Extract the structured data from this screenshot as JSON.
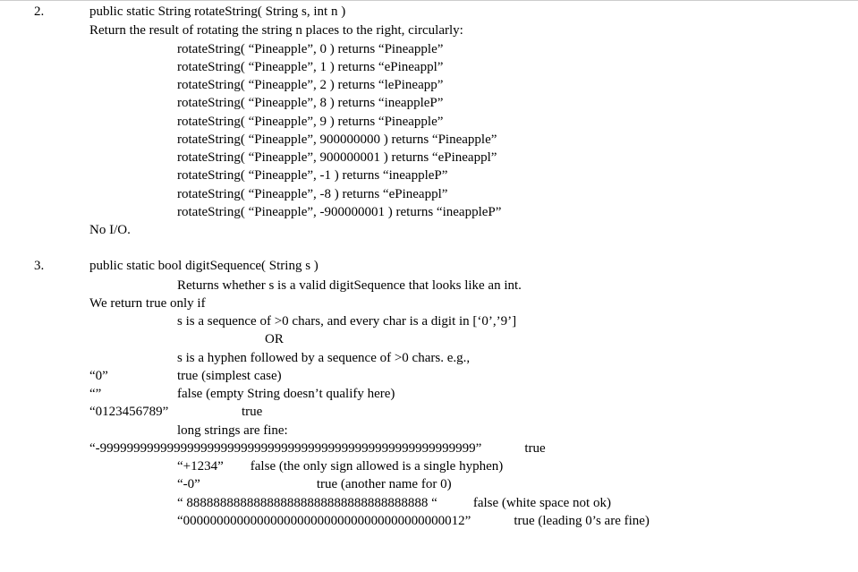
{
  "problem2": {
    "number": "2.",
    "signature": "public static String rotateString( String s, int n )",
    "description": "Return the result of rotating the string n places to the right, circularly:",
    "examples": [
      "rotateString( “Pineapple”, 0 ) returns “Pineapple”",
      "rotateString( “Pineapple”, 1 ) returns “ePineappl”",
      "rotateString( “Pineapple”, 2 ) returns “lePineapp”",
      "rotateString( “Pineapple”, 8 ) returns “ineappleP”",
      "rotateString( “Pineapple”, 9 ) returns “Pineapple”",
      "rotateString( “Pineapple”, 900000000 ) returns “Pineapple”",
      "rotateString( “Pineapple”, 900000001 ) returns “ePineappl”",
      "rotateString( “Pineapple”, -1 ) returns “ineappleP”",
      "rotateString( “Pineapple”, -8 ) returns “ePineappl”",
      "rotateString( “Pineapple”, -900000001 ) returns “ineappleP”"
    ],
    "note": "No I/O."
  },
  "problem3": {
    "number": "3.",
    "signature": "public static bool digitSequence( String s )",
    "description": "Returns whether s is a valid digitSequence that looks like an int.",
    "intro": "We return true only if",
    "rule1": "s is a sequence of >0 chars, and every char is a digit in [‘0’,’9’]",
    "or": "OR",
    "rule2": "s is a hyphen followed by a sequence of >0 chars. e.g.,",
    "ex1_input": "“0”",
    "ex1_result": "true (simplest case)",
    "ex2_input": "“”",
    "ex2_result": "false (empty String doesn’t qualify here)",
    "ex3_input": "“0123456789”",
    "ex3_result": "true",
    "long_note": "long strings are fine:",
    "ex4_input": "“-99999999999999999999999999999999999999999999999999999999”",
    "ex4_result": "true",
    "ex5_input": "“+1234”",
    "ex5_result": "false (the only sign allowed is a single hyphen)",
    "ex6_input": "“-0”",
    "ex6_result": "true (another name for 0)",
    "ex7_input": "“ 888888888888888888888888888888888888 “",
    "ex7_result": "false (white space not ok)",
    "ex8_input": "“000000000000000000000000000000000000000012”",
    "ex8_result": "true (leading 0’s are fine)"
  }
}
